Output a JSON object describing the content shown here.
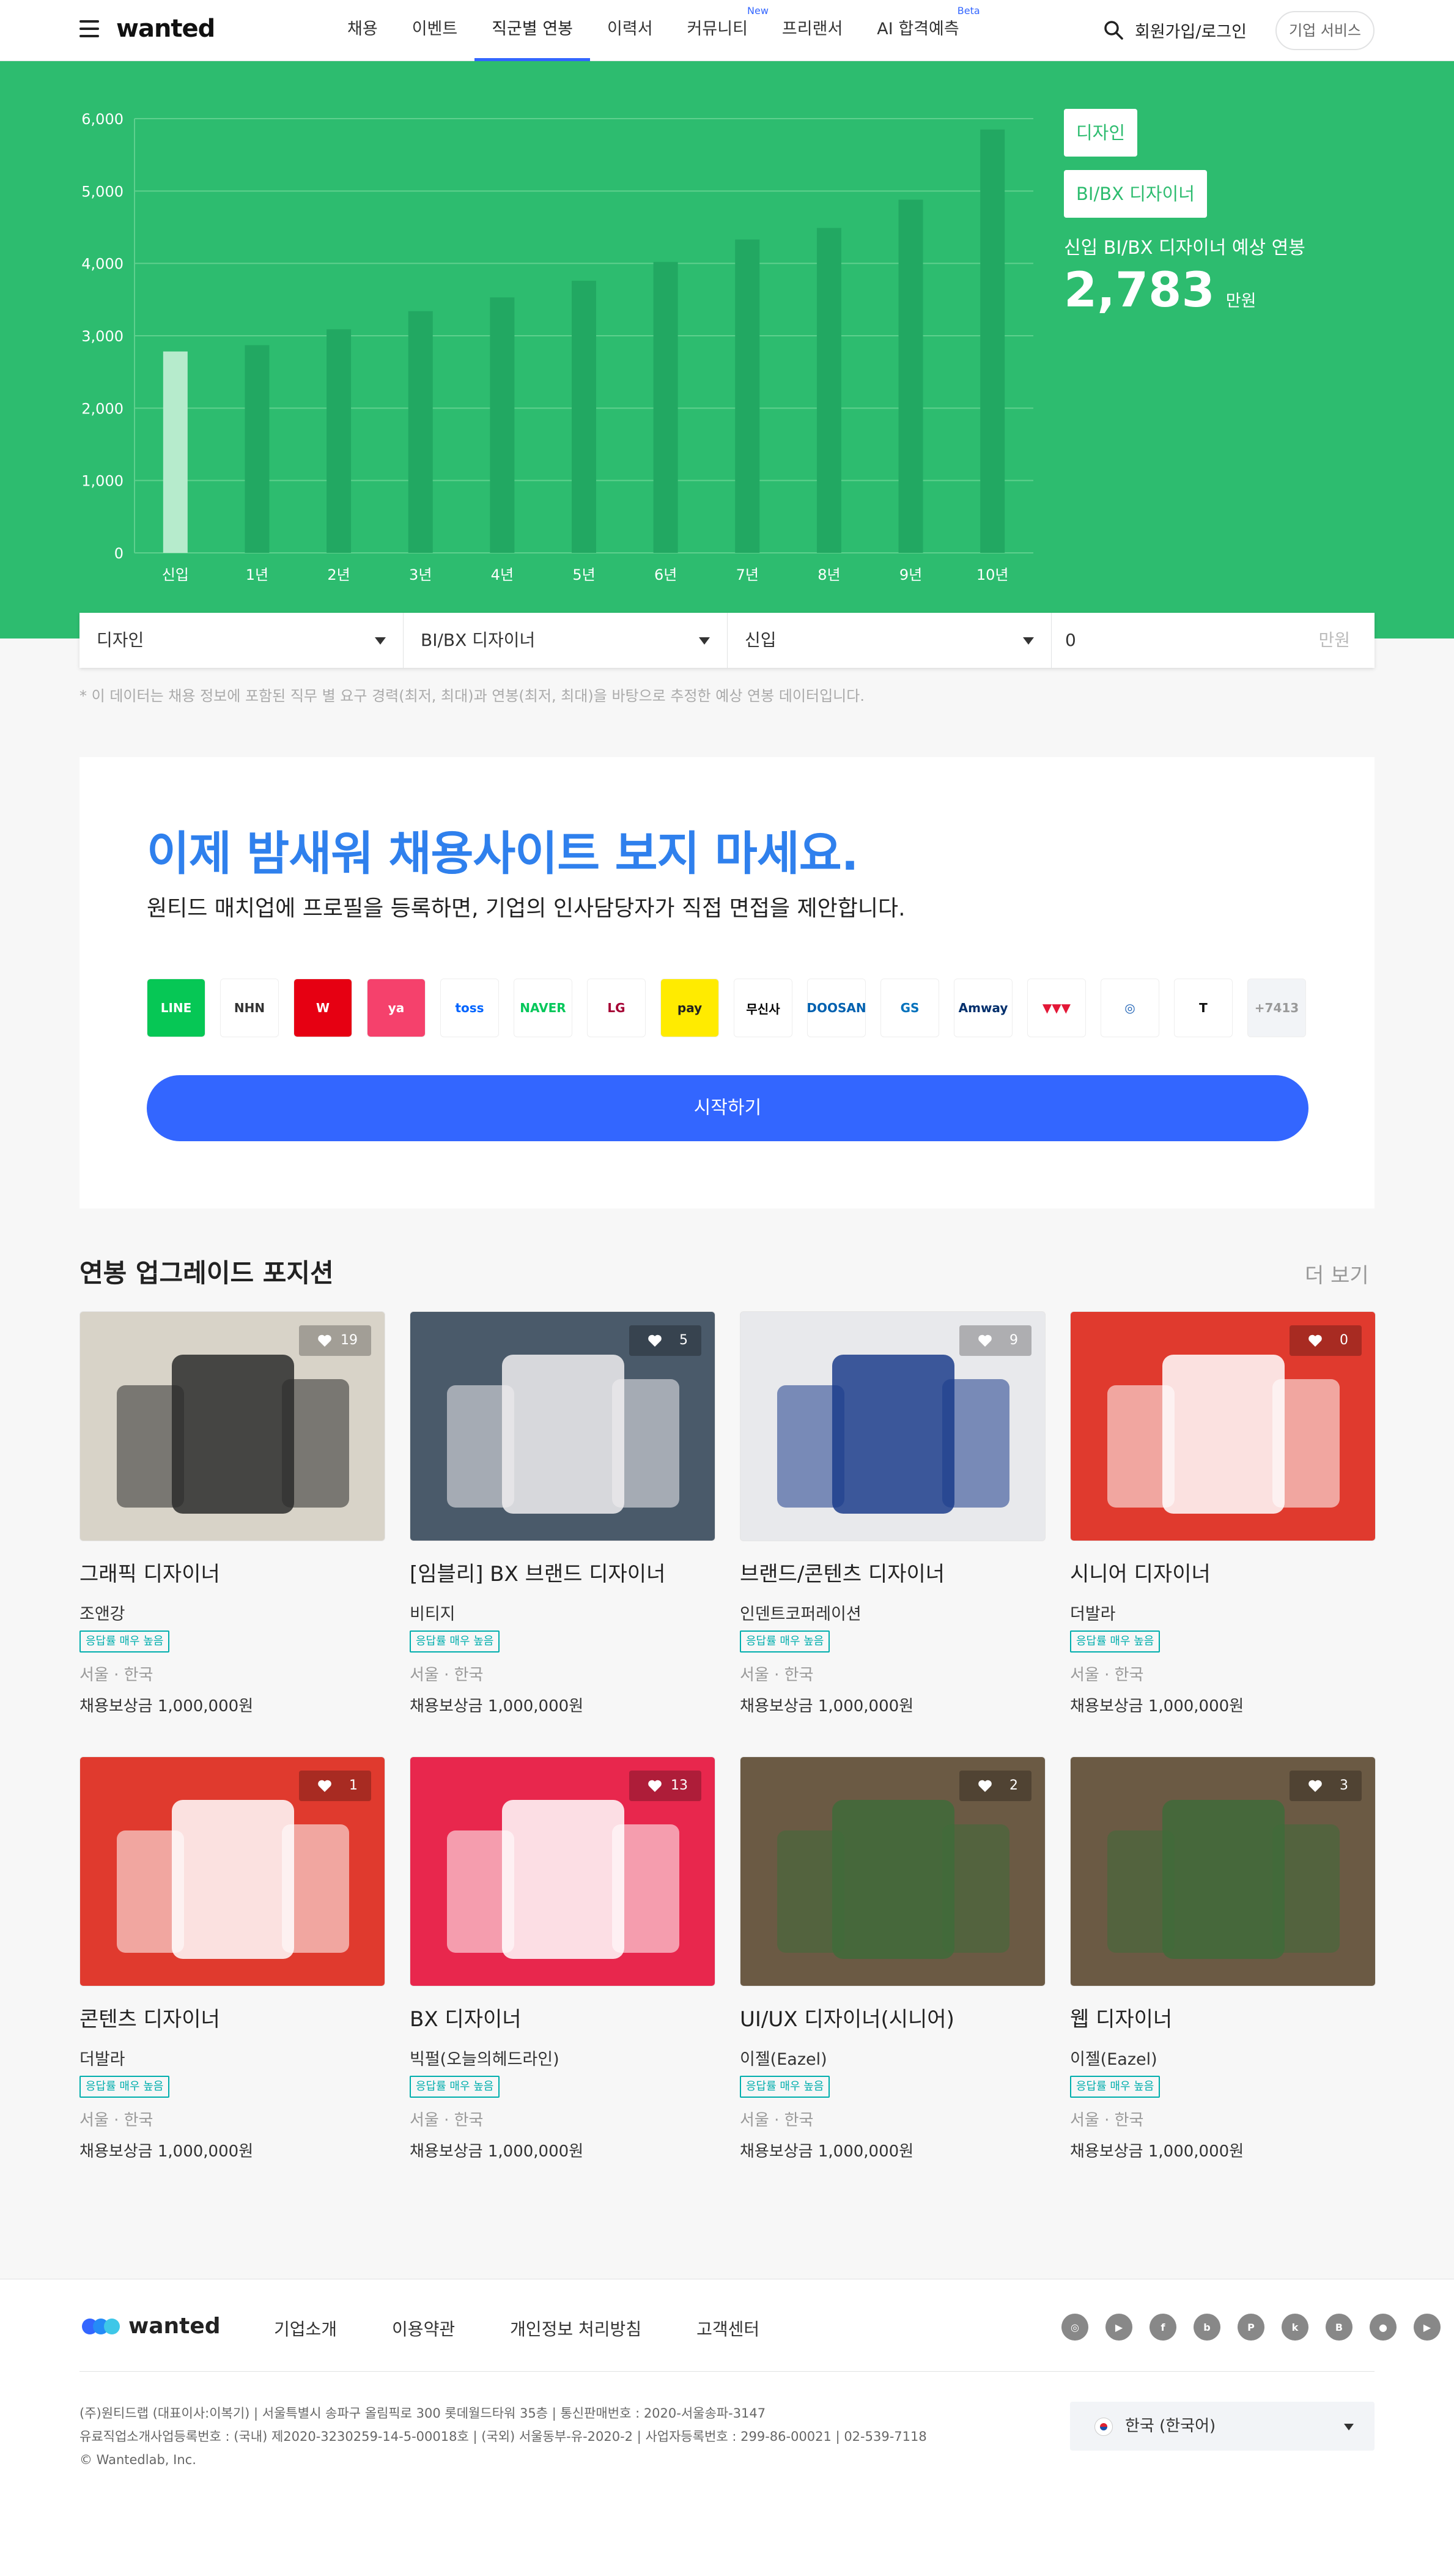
{
  "header": {
    "logo": "wanted",
    "nav": [
      {
        "label": "채용",
        "sup": ""
      },
      {
        "label": "이벤트",
        "sup": ""
      },
      {
        "label": "직군별 연봉",
        "sup": ""
      },
      {
        "label": "이력서",
        "sup": ""
      },
      {
        "label": "커뮤니티",
        "sup": "New"
      },
      {
        "label": "프리랜서",
        "sup": ""
      },
      {
        "label": "AI 합격예측",
        "sup": "Beta"
      }
    ],
    "login": "회원가입/로그인",
    "corp_service": "기업 서비스"
  },
  "hero": {
    "tag_job": "디자인",
    "tag_detail": "BI/BX 디자이너",
    "subtitle": "신입 BI/BX 디자이너 예상 연봉",
    "salary": "2,783",
    "unit": "만원"
  },
  "chart_data": {
    "type": "bar",
    "categories": [
      "신입",
      "1년",
      "2년",
      "3년",
      "4년",
      "5년",
      "6년",
      "7년",
      "8년",
      "9년",
      "10년"
    ],
    "values": [
      2783,
      2870,
      3090,
      3340,
      3530,
      3760,
      4020,
      4330,
      4490,
      4880,
      5850
    ],
    "ylim": [
      0,
      6000
    ],
    "yticks": [
      "0",
      "1,000",
      "2,000",
      "3,000",
      "4,000",
      "5,000",
      "6,000"
    ],
    "highlight_index": 0,
    "grid": true,
    "colors": {
      "highlight": "#b6ebcc",
      "bar": "#22a862",
      "grid": "#5fd08e",
      "text": "#ffffff"
    }
  },
  "filters": {
    "job": "디자인",
    "detail": "BI/BX 디자이너",
    "years": "신입",
    "salary_value": "0",
    "salary_unit": "만원",
    "note": "* 이 데이터는 채용 정보에 포함된 직무 별 요구 경력(최저, 최대)과 연봉(최저, 최대)을 바탕으로 추정한 예상 연봉 데이터입니다."
  },
  "promo": {
    "title": "이제 밤새워 채용사이트 보지 마세요.",
    "subtitle": "원티드 매치업에 프로필을 등록하면, 기업의 인사담당자가 직접 면접을 제안합니다.",
    "logos": [
      {
        "name": "LINE",
        "bg": "#06c755",
        "fg": "#ffffff"
      },
      {
        "name": "NHN",
        "bg": "#ffffff",
        "fg": "#333333"
      },
      {
        "name": "W",
        "bg": "#e60012",
        "fg": "#ffffff"
      },
      {
        "name": "ya",
        "bg": "#f5416c",
        "fg": "#ffffff"
      },
      {
        "name": "toss",
        "bg": "#ffffff",
        "fg": "#0064ff"
      },
      {
        "name": "NAVER",
        "bg": "#ffffff",
        "fg": "#03c75a"
      },
      {
        "name": "LG",
        "bg": "#ffffff",
        "fg": "#a50034"
      },
      {
        "name": "pay",
        "bg": "#ffeb00",
        "fg": "#222222"
      },
      {
        "name": "무신사",
        "bg": "#ffffff",
        "fg": "#000000"
      },
      {
        "name": "DOOSAN",
        "bg": "#ffffff",
        "fg": "#0061b0"
      },
      {
        "name": "GS",
        "bg": "#ffffff",
        "fg": "#0071bc"
      },
      {
        "name": "Amway",
        "bg": "#ffffff",
        "fg": "#002f6c"
      },
      {
        "name": "▼▼▼",
        "bg": "#ffffff",
        "fg": "#e31837"
      },
      {
        "name": "◎",
        "bg": "#ffffff",
        "fg": "#1a5fb4"
      },
      {
        "name": "T",
        "bg": "#ffffff",
        "fg": "#111111"
      },
      {
        "name": "+7413",
        "bg": "#f2f4f7",
        "fg": "#999999"
      }
    ],
    "cta": "시작하기"
  },
  "jobs_section": {
    "title": "연봉 업그레이드 포지션",
    "more": "더 보기"
  },
  "jobs": [
    {
      "title": "그래픽 디자이너",
      "company": "조앤강",
      "badge": "응답률 매우 높음",
      "location": "서울 · 한국",
      "reward": "채용보상금 1,000,000원",
      "likes": "19",
      "thumb_bg": "#d8d3c8",
      "thumb_accent": "#2b2b2b"
    },
    {
      "title": "[임블리] BX 브랜드 디자이너",
      "company": "비티지",
      "badge": "응답률 매우 높음",
      "location": "서울 · 한국",
      "reward": "채용보상금 1,000,000원",
      "likes": "5",
      "thumb_bg": "#4a5a6a",
      "thumb_accent": "#f0eef0"
    },
    {
      "title": "브랜드/콘텐츠 디자이너",
      "company": "인덴트코퍼레이션",
      "badge": "응답률 매우 높음",
      "location": "서울 · 한국",
      "reward": "채용보상금 1,000,000원",
      "likes": "9",
      "thumb_bg": "#e8e9ec",
      "thumb_accent": "#1c3d8c"
    },
    {
      "title": "시니어 디자이너",
      "company": "더발라",
      "badge": "응답률 매우 높음",
      "location": "서울 · 한국",
      "reward": "채용보상금 1,000,000원",
      "likes": "0",
      "thumb_bg": "#e03a2e",
      "thumb_accent": "#ffffff"
    },
    {
      "title": "콘텐츠 디자이너",
      "company": "더발라",
      "badge": "응답률 매우 높음",
      "location": "서울 · 한국",
      "reward": "채용보상금 1,000,000원",
      "likes": "1",
      "thumb_bg": "#e03a2e",
      "thumb_accent": "#ffffff"
    },
    {
      "title": "BX 디자이너",
      "company": "빅펄(오늘의헤드라인)",
      "badge": "응답률 매우 높음",
      "location": "서울 · 한국",
      "reward": "채용보상금 1,000,000원",
      "likes": "13",
      "thumb_bg": "#e8274d",
      "thumb_accent": "#ffffff"
    },
    {
      "title": "UI/UX 디자이너(시니어)",
      "company": "이젤(Eazel)",
      "badge": "응답률 매우 높음",
      "location": "서울 · 한국",
      "reward": "채용보상금 1,000,000원",
      "likes": "2",
      "thumb_bg": "#6b5a44",
      "thumb_accent": "#3f6b3a"
    },
    {
      "title": "웹 디자이너",
      "company": "이젤(Eazel)",
      "badge": "응답률 매우 높음",
      "location": "서울 · 한국",
      "reward": "채용보상금 1,000,000원",
      "likes": "3",
      "thumb_bg": "#6b5a44",
      "thumb_accent": "#3f6b3a"
    }
  ],
  "footer": {
    "logo": "wanted",
    "links": [
      "기업소개",
      "이용약관",
      "개인정보 처리방침",
      "고객센터"
    ],
    "social_icons": [
      "instagram-icon",
      "youtube-icon",
      "facebook-icon",
      "blog-icon",
      "post-icon",
      "kakao-icon",
      "brunch-icon",
      "apple-icon",
      "google-play-icon"
    ],
    "info_lines": [
      "(주)원티드랩 (대표이사:이복기) | 서울특별시 송파구 올림픽로 300 롯데월드타워 35층 | 통신판매번호 : 2020-서울송파-3147",
      "유료직업소개사업등록번호 : (국내) 제2020-3230259-14-5-00018호 | (국외) 서울동부-유-2020-2 | 사업자등록번호 : 299-86-00021 | 02-539-7118",
      "© Wantedlab, Inc."
    ],
    "language": "한국 (한국어)"
  }
}
